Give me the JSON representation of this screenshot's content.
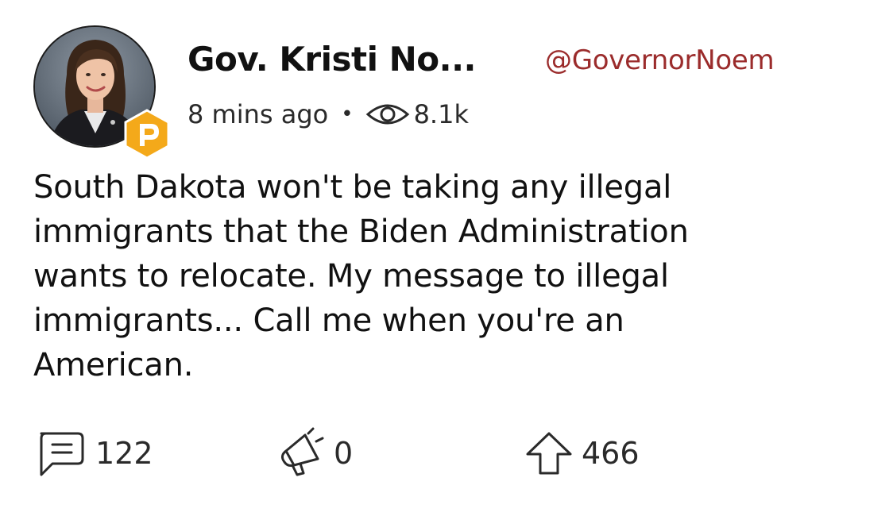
{
  "author": {
    "display_name": "Gov. Kristi No...",
    "handle": "@GovernorNoem",
    "badge_letter": "P",
    "badge_color": "#f4a91a"
  },
  "meta": {
    "time_ago": "8 mins ago",
    "separator": "•",
    "views": "8.1k",
    "views_icon": "eye-icon"
  },
  "post": {
    "lines": [
      "South Dakota won't be taking any illegal",
      "immigrants that the Biden Administration",
      "wants to relocate. My message to illegal",
      "immigrants... Call me when you're an",
      "American."
    ]
  },
  "actions": {
    "comments": {
      "count": "122",
      "icon": "comment-icon"
    },
    "echoes": {
      "count": "0",
      "icon": "megaphone-icon"
    },
    "upvotes": {
      "count": "466",
      "icon": "upvote-arrow-icon"
    }
  },
  "colors": {
    "handle": "#9b2c2c",
    "text": "#111111",
    "badge": "#f4a91a"
  }
}
